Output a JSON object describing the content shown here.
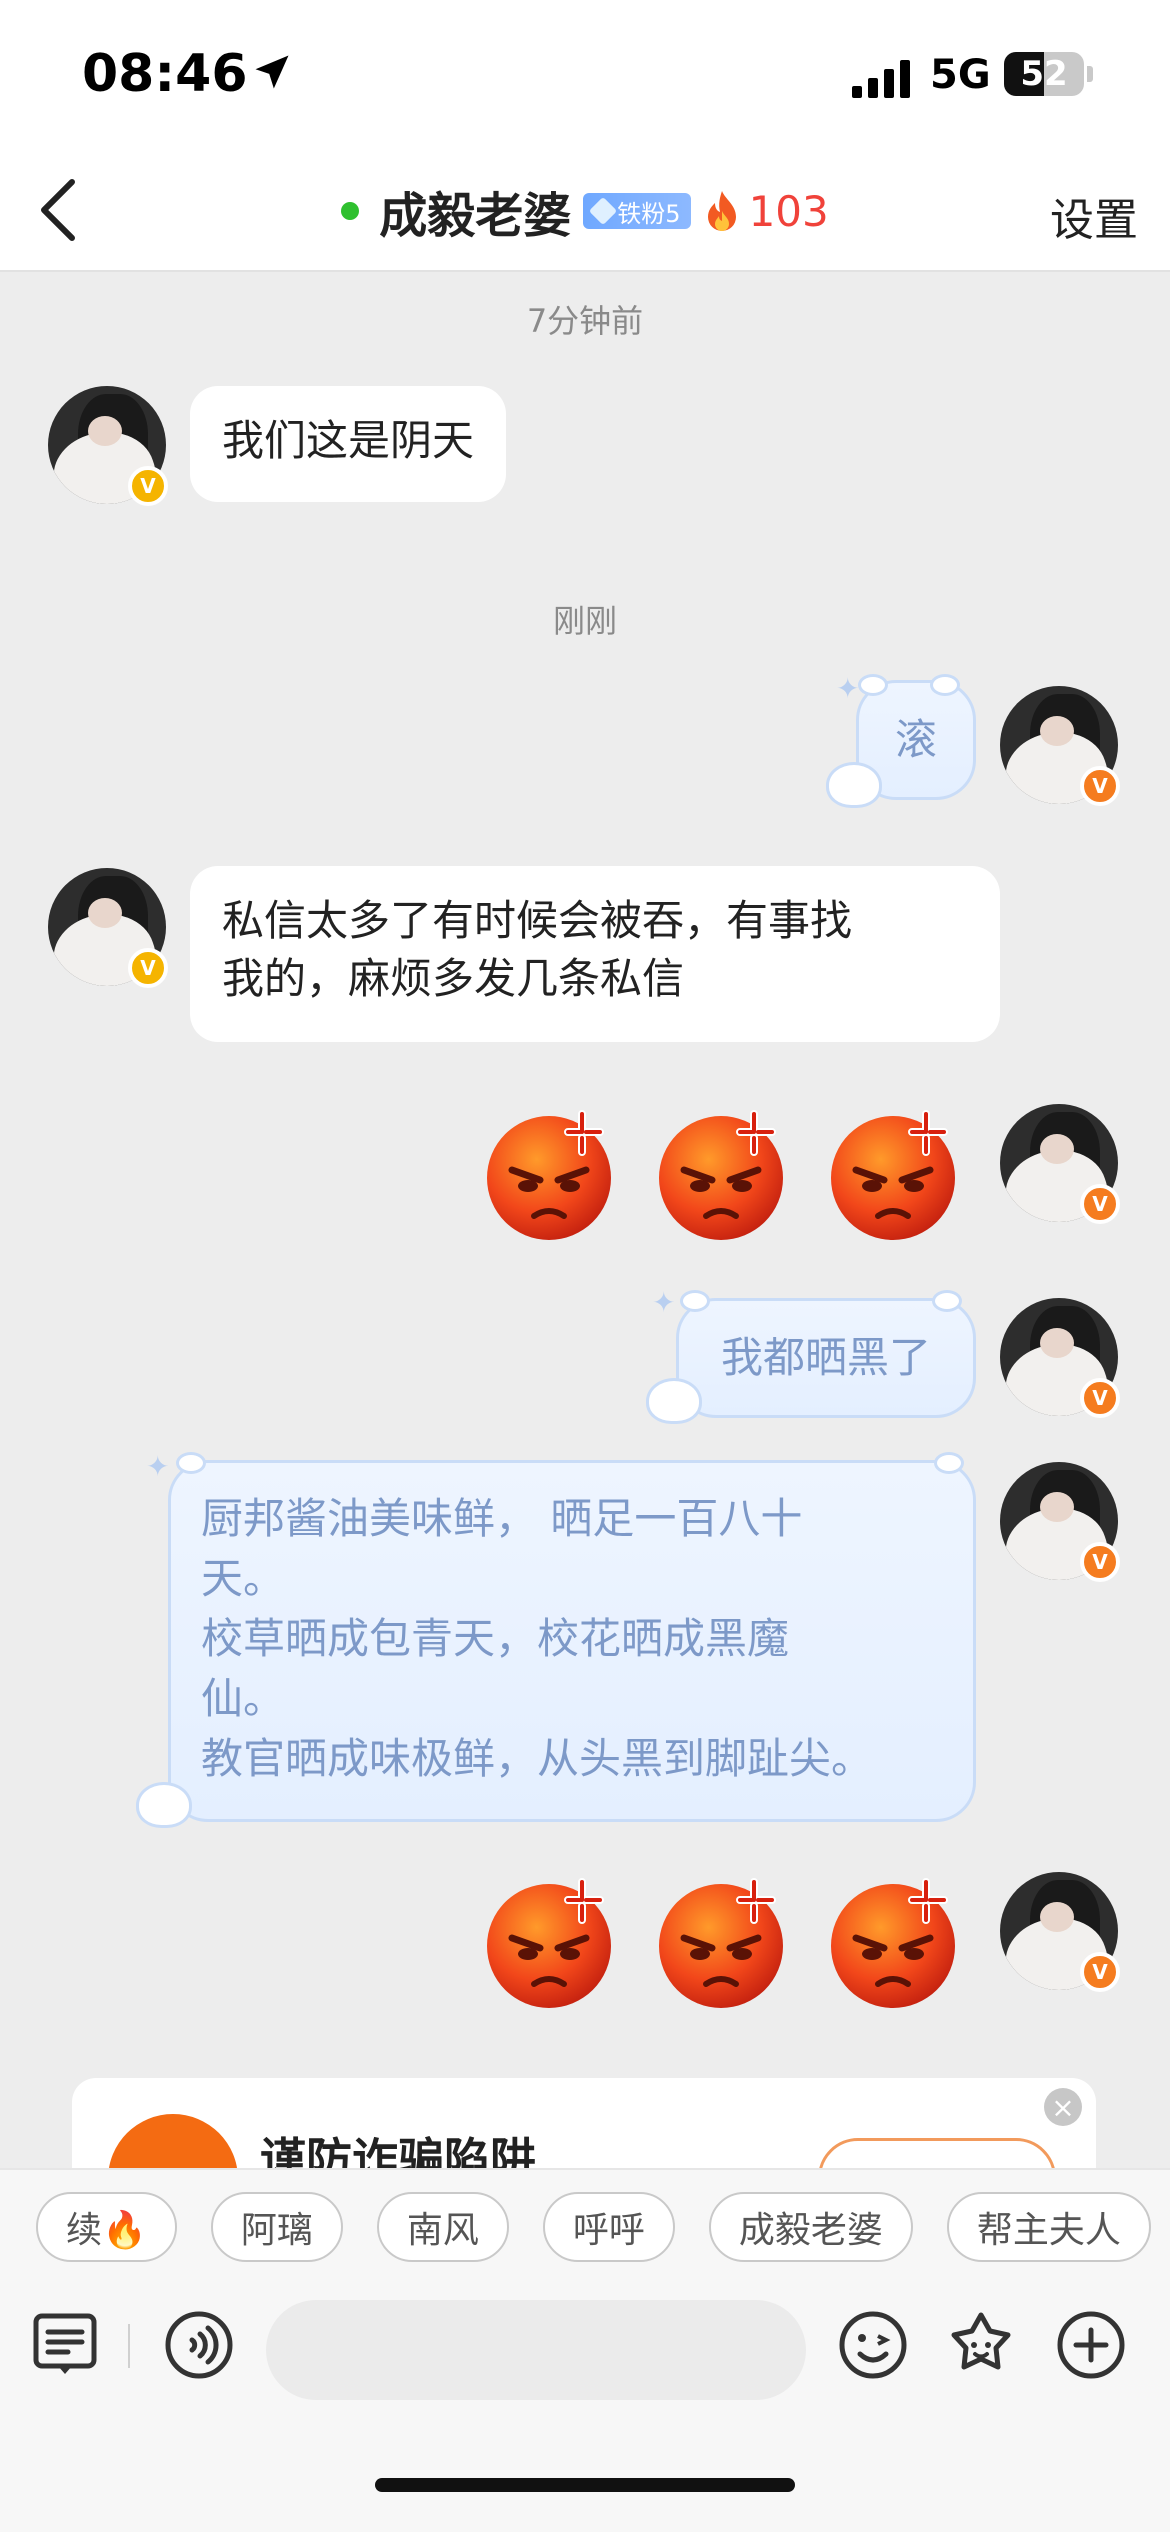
{
  "status_bar": {
    "time": "08:46",
    "network": "5G",
    "battery": "52"
  },
  "nav": {
    "contact_name": "成毅老婆",
    "fan_badge": "铁粉5",
    "fire_count": "103",
    "settings_label": "设置"
  },
  "messages": {
    "ts1": "7分钟前",
    "ts2": "刚刚",
    "m1": "我们这是阴天",
    "m2": "滚",
    "m3_line1": "私信太多了有时候会被吞，有事找",
    "m3_line2": "我的，麻烦多发几条私信",
    "m4": "我都晒黑了",
    "m5_line1": "厨邦酱油美味鲜， 晒足一百八十",
    "m5_line2": "天。",
    "m5_line3": "校草晒成包青天，校花晒成黑魔",
    "m5_line4": "仙。",
    "m5_line5": "教官晒成味极鲜，从头黑到脚趾尖。"
  },
  "safety_card": {
    "title": "谨防诈骗陷阱"
  },
  "quick_tags": [
    "续🔥",
    "阿璃",
    "南风",
    "呼呼",
    "成毅老婆",
    "帮主夫人"
  ],
  "icons": {
    "back": "chevron-left-icon",
    "location": "location-arrow-icon",
    "fire": "fire-icon",
    "menu": "menu-list-icon",
    "voice": "voice-icon",
    "emoji": "smiley-icon",
    "sticker": "sticker-icon",
    "plus": "plus-icon",
    "angry_emoji": "angry-face-emoji"
  },
  "colors": {
    "fire": "#f0423a",
    "online": "#2fc02f",
    "cute_text": "#7d99c8",
    "badge": "#6fa8ff"
  }
}
